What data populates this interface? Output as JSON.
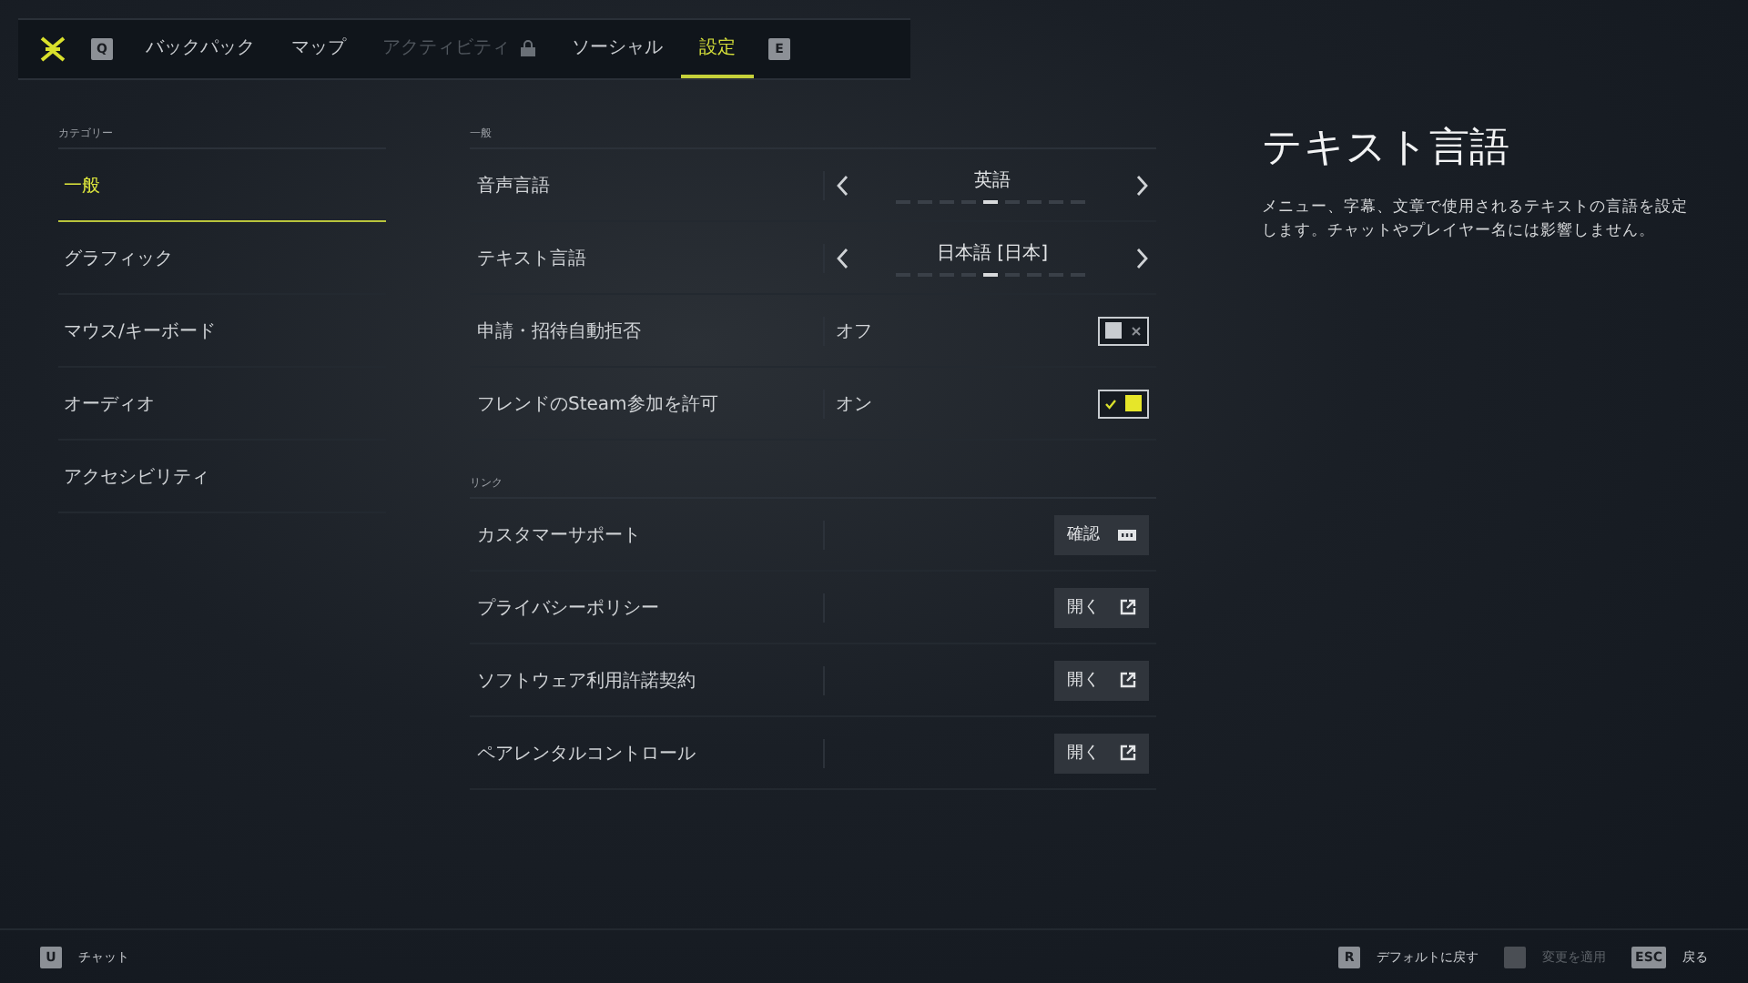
{
  "top_nav": {
    "prev_key": "Q",
    "next_key": "E",
    "tabs": [
      {
        "label": "バックパック",
        "selected": false,
        "locked": false
      },
      {
        "label": "マップ",
        "selected": false,
        "locked": false
      },
      {
        "label": "アクティビティ",
        "selected": false,
        "locked": true
      },
      {
        "label": "ソーシャル",
        "selected": false,
        "locked": false
      },
      {
        "label": "設定",
        "selected": true,
        "locked": false
      }
    ]
  },
  "sidebar": {
    "heading": "カテゴリー",
    "items": [
      {
        "label": "一般",
        "selected": true
      },
      {
        "label": "グラフィック",
        "selected": false
      },
      {
        "label": "マウス/キーボード",
        "selected": false
      },
      {
        "label": "オーディオ",
        "selected": false
      },
      {
        "label": "アクセシビリティ",
        "selected": false
      }
    ]
  },
  "sections": [
    {
      "heading": "一般",
      "rows": [
        {
          "kind": "selector",
          "label": "音声言語",
          "value": "英語"
        },
        {
          "kind": "selector",
          "label": "テキスト言語",
          "value": "日本語 [日本]"
        },
        {
          "kind": "toggle",
          "label": "申請・招待自動拒否",
          "value": "オフ",
          "on": false
        },
        {
          "kind": "toggle",
          "label": "フレンドのSteam参加を許可",
          "value": "オン",
          "on": true
        }
      ]
    },
    {
      "heading": "リンク",
      "rows": [
        {
          "kind": "chat_link",
          "label": "カスタマーサポート",
          "button": "確認"
        },
        {
          "kind": "external_link",
          "label": "プライバシーポリシー",
          "button": "開く"
        },
        {
          "kind": "external_link",
          "label": "ソフトウェア利用許諾契約",
          "button": "開く"
        },
        {
          "kind": "external_link",
          "label": "ペアレンタルコントロール",
          "button": "開く"
        }
      ]
    }
  ],
  "detail": {
    "title": "テキスト言語",
    "description": "メニュー、字幕、文章で使用されるテキストの言語を設定します。チャットやプレイヤー名には影響しません。"
  },
  "footer": {
    "left": [
      {
        "key": "U",
        "label": "チャット",
        "disabled": false
      }
    ],
    "right": [
      {
        "key": "R",
        "label": "デフォルトに戻す",
        "disabled": false
      },
      {
        "label": "変更を適用",
        "disabled": true
      },
      {
        "key": "ESC",
        "label": "戻る",
        "disabled": false
      }
    ]
  }
}
